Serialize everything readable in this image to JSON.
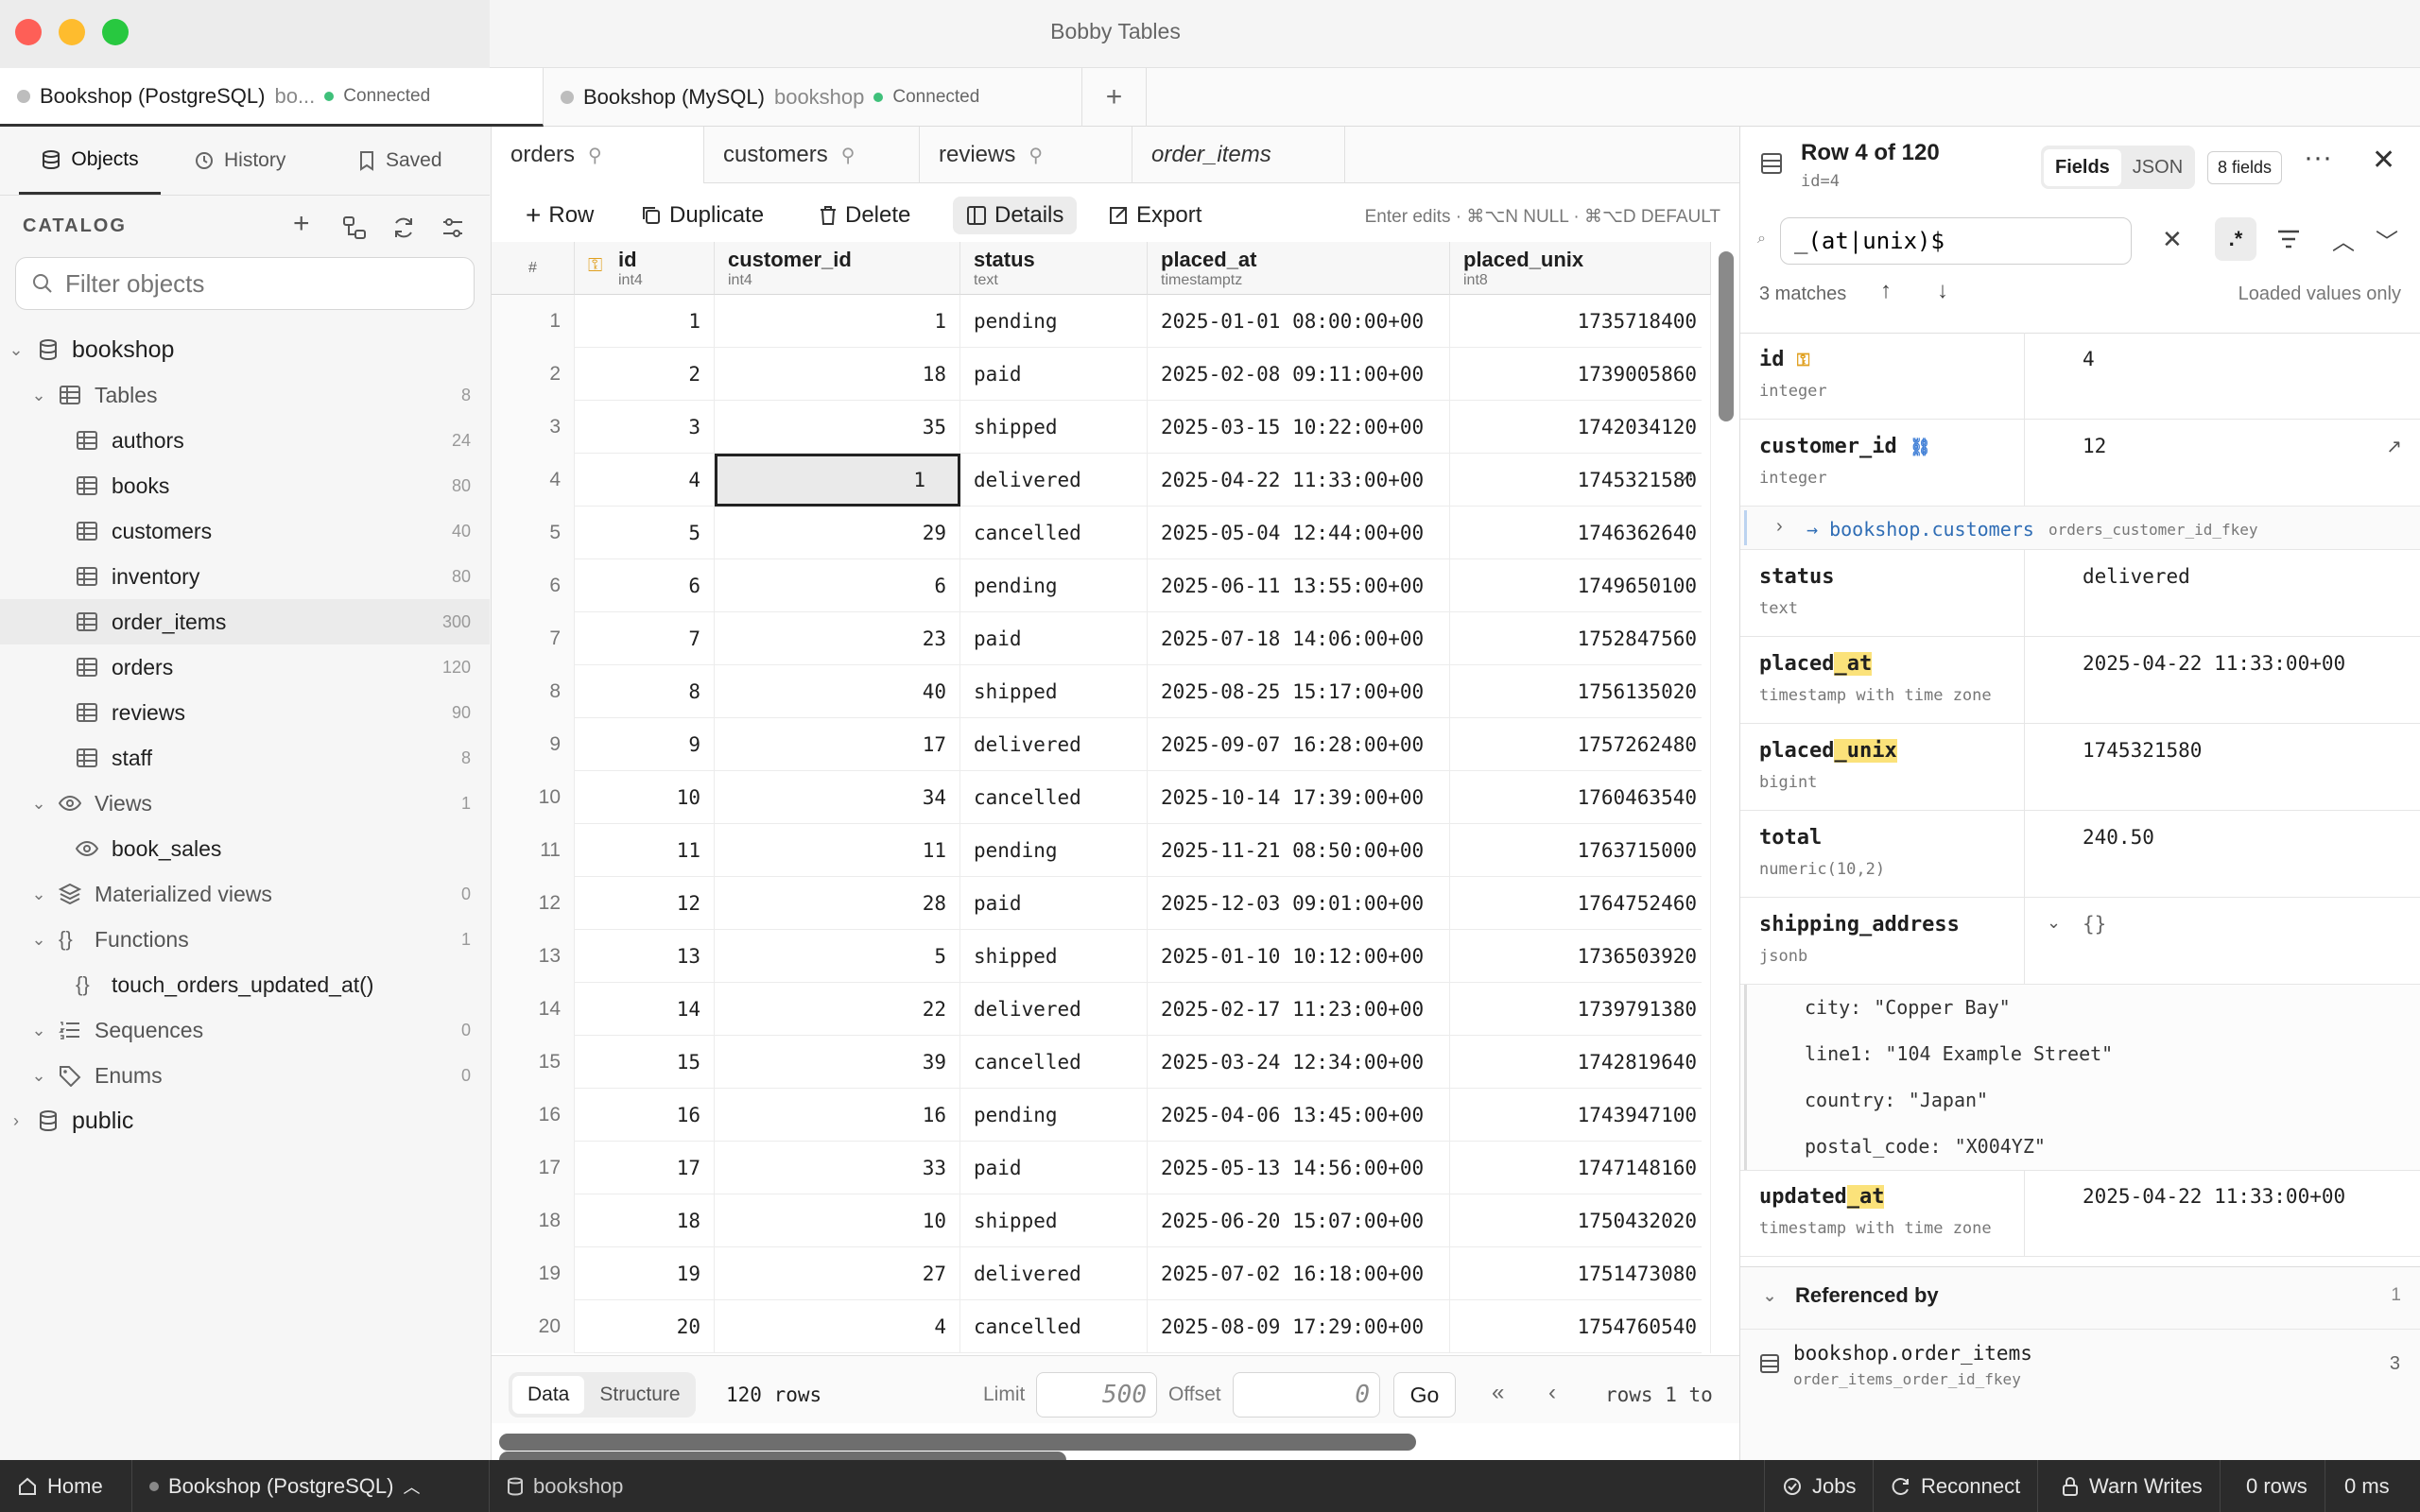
{
  "window": {
    "title": "Bobby Tables",
    "lights": {
      "close": "#fe5f57",
      "minimize": "#febc2e",
      "zoom": "#28c840"
    }
  },
  "connection_tabs": [
    {
      "name": "Bookshop (PostgreSQL)",
      "sub": "bo...",
      "status": "Connected"
    },
    {
      "name": "Bookshop (MySQL)",
      "sub": "bookshop",
      "status": "Connected"
    }
  ],
  "new_tab": "+",
  "sidebar": {
    "tabs": [
      "Objects",
      "History",
      "Saved"
    ],
    "catalog": "CATALOG",
    "filter_placeholder": "Filter objects",
    "db": "bookshop",
    "groups": {
      "tables": {
        "label": "Tables",
        "count": "8"
      },
      "views": {
        "label": "Views",
        "count": "1"
      },
      "matviews": {
        "label": "Materialized views",
        "count": "0"
      },
      "functions": {
        "label": "Functions",
        "count": "1"
      },
      "sequences": {
        "label": "Sequences",
        "count": "0"
      },
      "enums": {
        "label": "Enums",
        "count": "0"
      }
    },
    "tables": [
      {
        "name": "authors",
        "count": "24"
      },
      {
        "name": "books",
        "count": "80"
      },
      {
        "name": "customers",
        "count": "40"
      },
      {
        "name": "inventory",
        "count": "80"
      },
      {
        "name": "order_items",
        "count": "300"
      },
      {
        "name": "orders",
        "count": "120"
      },
      {
        "name": "reviews",
        "count": "90"
      },
      {
        "name": "staff",
        "count": "8"
      }
    ],
    "views": [
      "book_sales"
    ],
    "functions": [
      "touch_orders_updated_at()"
    ],
    "schema2": "public"
  },
  "table_tabs": [
    "orders",
    "customers",
    "reviews",
    "order_items"
  ],
  "toolbar": {
    "row": "Row",
    "duplicate": "Duplicate",
    "delete": "Delete",
    "details": "Details",
    "export": "Export",
    "hint": "Enter edits · ⌘⌥N NULL · ⌘⌥D DEFAULT"
  },
  "columns": [
    {
      "name": "id",
      "type": "int4"
    },
    {
      "name": "customer_id",
      "type": "int4"
    },
    {
      "name": "status",
      "type": "text"
    },
    {
      "name": "placed_at",
      "type": "timestamptz"
    },
    {
      "name": "placed_unix",
      "type": "int8"
    }
  ],
  "rownum_header": "#",
  "rows": [
    [
      "1",
      "1",
      "1",
      "pending",
      "2025-01-01 08:00:00+00",
      "1735718400"
    ],
    [
      "2",
      "2",
      "18",
      "paid",
      "2025-02-08 09:11:00+00",
      "1739005860"
    ],
    [
      "3",
      "3",
      "35",
      "shipped",
      "2025-03-15 10:22:00+00",
      "1742034120"
    ],
    [
      "4",
      "4",
      "1",
      "delivered",
      "2025-04-22 11:33:00+00",
      "1745321580"
    ],
    [
      "5",
      "5",
      "29",
      "cancelled",
      "2025-05-04 12:44:00+00",
      "1746362640"
    ],
    [
      "6",
      "6",
      "6",
      "pending",
      "2025-06-11 13:55:00+00",
      "1749650100"
    ],
    [
      "7",
      "7",
      "23",
      "paid",
      "2025-07-18 14:06:00+00",
      "1752847560"
    ],
    [
      "8",
      "8",
      "40",
      "shipped",
      "2025-08-25 15:17:00+00",
      "1756135020"
    ],
    [
      "9",
      "9",
      "17",
      "delivered",
      "2025-09-07 16:28:00+00",
      "1757262480"
    ],
    [
      "10",
      "10",
      "34",
      "cancelled",
      "2025-10-14 17:39:00+00",
      "1760463540"
    ],
    [
      "11",
      "11",
      "11",
      "pending",
      "2025-11-21 08:50:00+00",
      "1763715000"
    ],
    [
      "12",
      "12",
      "28",
      "paid",
      "2025-12-03 09:01:00+00",
      "1764752460"
    ],
    [
      "13",
      "13",
      "5",
      "shipped",
      "2025-01-10 10:12:00+00",
      "1736503920"
    ],
    [
      "14",
      "14",
      "22",
      "delivered",
      "2025-02-17 11:23:00+00",
      "1739791380"
    ],
    [
      "15",
      "15",
      "39",
      "cancelled",
      "2025-03-24 12:34:00+00",
      "1742819640"
    ],
    [
      "16",
      "16",
      "16",
      "pending",
      "2025-04-06 13:45:00+00",
      "1743947100"
    ],
    [
      "17",
      "17",
      "33",
      "paid",
      "2025-05-13 14:56:00+00",
      "1747148160"
    ],
    [
      "18",
      "18",
      "10",
      "shipped",
      "2025-06-20 15:07:00+00",
      "1750432020"
    ],
    [
      "19",
      "19",
      "27",
      "delivered",
      "2025-07-02 16:18:00+00",
      "1751473080"
    ],
    [
      "20",
      "20",
      "4",
      "cancelled",
      "2025-08-09 17:29:00+00",
      "1754760540"
    ]
  ],
  "footer": {
    "data": "Data",
    "structure": "Structure",
    "rows": "120 rows",
    "limit_label": "Limit",
    "limit": "500",
    "offset_label": "Offset",
    "offset": "0",
    "go": "Go",
    "range": "rows 1 to"
  },
  "detail": {
    "title": "Row 4 of 120",
    "subtitle": "id=4",
    "fields_tab": "Fields",
    "json_tab": "JSON",
    "fields_count": "8 fields",
    "search": "_(at|unix)$",
    "matches": "3 matches",
    "loaded": "Loaded values only",
    "fields": [
      {
        "pre": "id",
        "hl": "",
        "type": "integer",
        "value": "4"
      },
      {
        "pre": "customer_id",
        "hl": "",
        "type": "integer",
        "value": "12"
      },
      {
        "pre": "status",
        "hl": "",
        "type": "text",
        "value": "delivered"
      },
      {
        "pre": "placed",
        "hl": "_at",
        "type": "timestamp with time zone",
        "value": "2025-04-22 11:33:00+00"
      },
      {
        "pre": "placed",
        "hl": "_unix",
        "type": "bigint",
        "value": "1745321580"
      },
      {
        "pre": "total",
        "hl": "",
        "type": "numeric(10,2)",
        "value": "240.50"
      },
      {
        "pre": "shipping_address",
        "hl": "",
        "type": "jsonb",
        "value": "{}"
      },
      {
        "pre": "updated",
        "hl": "_at",
        "type": "timestamp with time zone",
        "value": "2025-04-22 11:33:00+00"
      }
    ],
    "fk": {
      "target": "→ bookshop.customers",
      "constraint": "orders_customer_id_fkey"
    },
    "json_lines": [
      {
        "k": "city:",
        "v": "\"Copper Bay\""
      },
      {
        "k": "line1:",
        "v": "\"104 Example Street\""
      },
      {
        "k": "country:",
        "v": "\"Japan\""
      },
      {
        "k": "postal_code:",
        "v": "\"X004YZ\""
      }
    ],
    "referenced_by": {
      "label": "Referenced by",
      "count": "1",
      "table": "bookshop.order_items",
      "constraint": "order_items_order_id_fkey",
      "rows": "3"
    }
  },
  "statusbar": {
    "home": "Home",
    "conn": "Bookshop (PostgreSQL)",
    "db": "bookshop",
    "jobs": "Jobs",
    "reconnect": "Reconnect",
    "warn": "Warn Writes",
    "rows": "0 rows",
    "ms": "0 ms"
  }
}
